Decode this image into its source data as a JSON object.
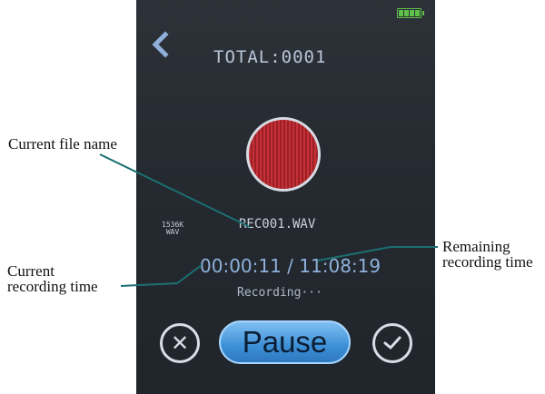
{
  "device": {
    "total_label": "TOTAL:0001",
    "format_badge": [
      "1536K",
      "WAV"
    ],
    "file_name": "REC001.WAV",
    "time_display": "00:00:11 / 11:08:19",
    "status_text": "Recording···",
    "pause_label": "Pause",
    "cancel_glyph": "✕",
    "icons": [
      "back-arrow-icon",
      "battery-icon",
      "record-icon",
      "cancel-icon",
      "confirm-check-icon"
    ]
  },
  "annotations": {
    "file_name": "Current file name",
    "current_time": [
      "Current",
      "recording time"
    ],
    "remaining_time": [
      "Remaining",
      "recording time"
    ]
  },
  "colors": {
    "record_red": "#c43137",
    "pause_blue": "#3c8fd6",
    "battery_green": "#5fc04a"
  }
}
